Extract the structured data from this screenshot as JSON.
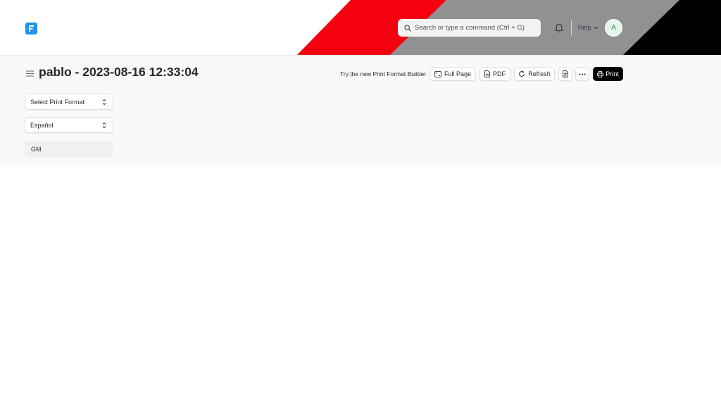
{
  "navbar": {
    "search_placeholder": "Search or type a command (Ctrl + G)",
    "help_label": "Help",
    "avatar_initial": "A",
    "stripe_colors": [
      "#f5000f",
      "#919194",
      "#000000"
    ],
    "logo_color": "#2490ef"
  },
  "page": {
    "title": "pablo - 2023-08-16 12:33:04",
    "try_new_label": "Try the new Print Format Builder",
    "buttons": {
      "full_page": "Full Page",
      "pdf": "PDF",
      "refresh": "Refresh",
      "print": "Print"
    },
    "print_format_select": "Select Print Format",
    "language_select": "Español",
    "letterhead": "GM"
  }
}
